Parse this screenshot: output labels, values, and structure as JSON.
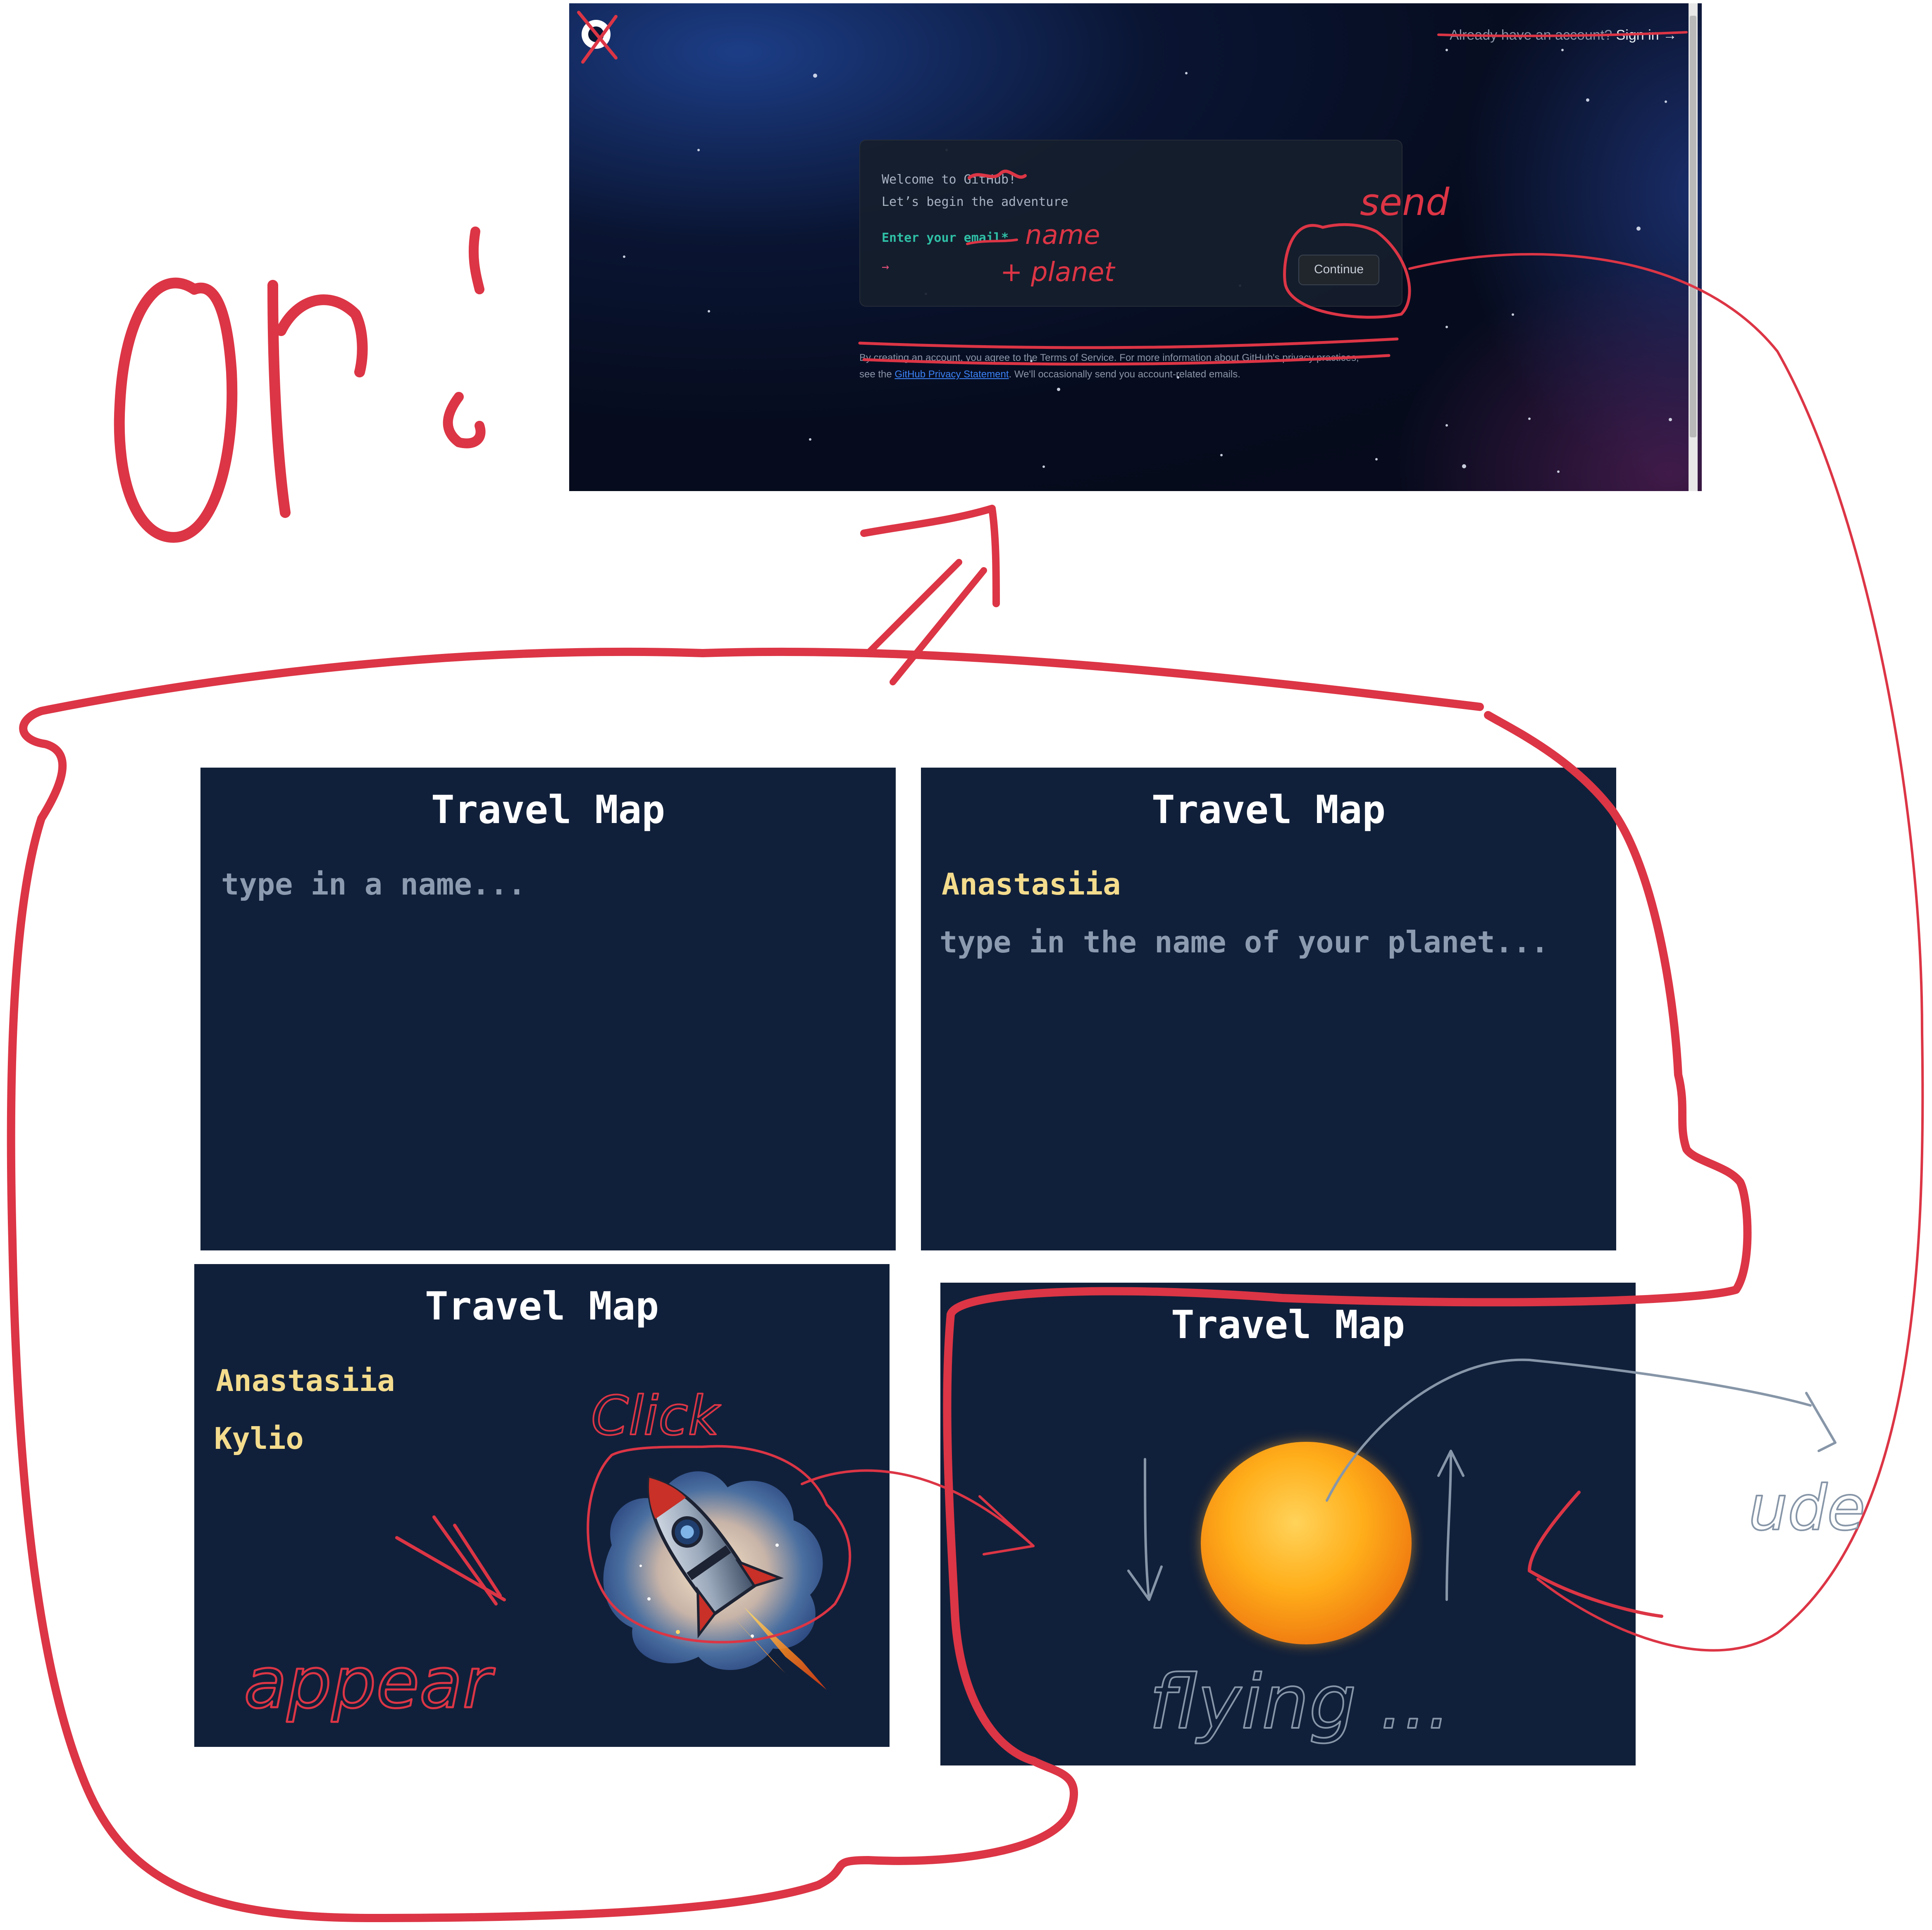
{
  "screenshot": {
    "signin_prompt": "Already have an account?",
    "signin_link": "Sign in →",
    "welcome_line1": "Welcome to GitHub!",
    "welcome_line2": "Let’s begin the adventure",
    "enter_label": "Enter your email*",
    "input_arrow": "→",
    "continue_label": "Continue",
    "legal_text_1": "By creating an account, you agree to the Terms of Service. For more information about GitHub's privacy practices,",
    "legal_text_2_prefix": "see the ",
    "legal_link": "GitHub Privacy Statement",
    "legal_text_2_suffix": ". We'll occasionally send you account-related emails.",
    "colors": {
      "accent_teal": "#2fbfa6",
      "arrow_pink": "#e04f78",
      "link_blue": "#3b82f6"
    }
  },
  "annotations": {
    "or_label": "Or:",
    "send_label": "send",
    "name_label": "name",
    "planet_label": "+ planet",
    "click_label": "Click",
    "appear_label": "appear",
    "flying_label": "flying ...",
    "ude_label": "ude",
    "stroke_color": "#dc3545",
    "grey_color": "#8796a8"
  },
  "panels": [
    {
      "title": "Travel Map",
      "placeholder": "type in a name..."
    },
    {
      "title": "Travel Map",
      "name": "Anastasiia",
      "placeholder": "type in the name of your planet..."
    },
    {
      "title": "Travel Map",
      "name": "Anastasiia",
      "planet": "Kylio",
      "image": "rocket-icon"
    },
    {
      "title": "Travel Map",
      "image": "sun-icon"
    }
  ],
  "panel_color": "#11203a",
  "name_color": "#f4dc8d",
  "placeholder_color": "#8d9bb0"
}
